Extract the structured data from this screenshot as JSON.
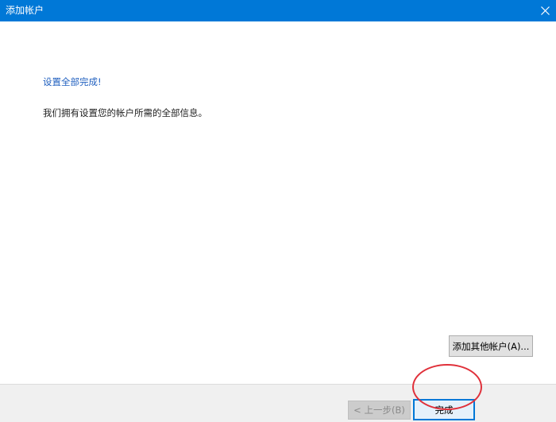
{
  "window": {
    "title": "添加帐户",
    "close_icon": "close-icon"
  },
  "main": {
    "heading": "设置全部完成!",
    "message": "我们拥有设置您的帐户所需的全部信息。",
    "add_account_button": "添加其他帐户(A)..."
  },
  "footer": {
    "back_button": "< 上一步(B)",
    "finish_button": "完成"
  },
  "colors": {
    "titlebar": "#0078d7",
    "heading": "#1f5fbf",
    "annotation": "#e0303a"
  }
}
